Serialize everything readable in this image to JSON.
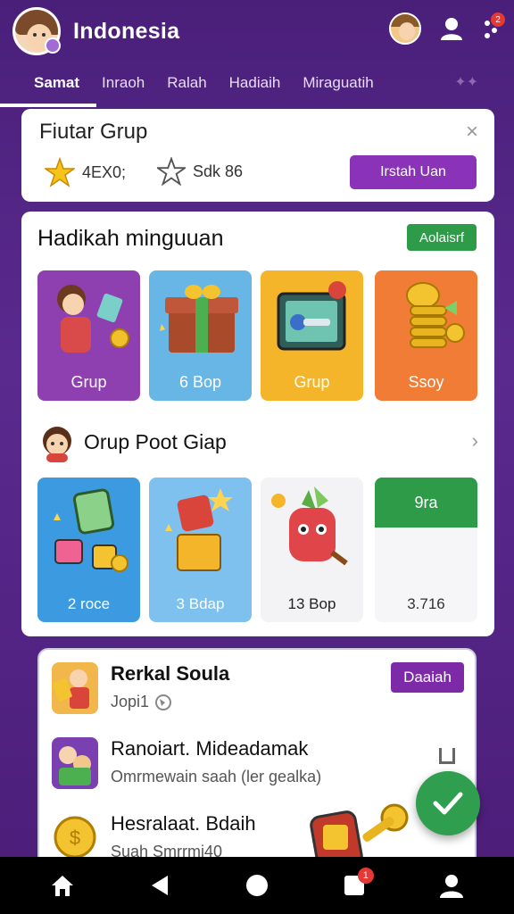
{
  "header": {
    "title": "Indonesia",
    "notification_badge": "2"
  },
  "tabs": [
    {
      "label": "Samat",
      "active": true
    },
    {
      "label": "Inraoh",
      "active": false
    },
    {
      "label": "Ralah",
      "active": false
    },
    {
      "label": "Hadiaih",
      "active": false
    },
    {
      "label": "Miraguatih",
      "active": false
    }
  ],
  "feature_card": {
    "title": "Fiutar Grup",
    "stat1": "4EX0;",
    "stat2": "Sdk 86",
    "button_label": "Irstah Uan",
    "close_glyph": "×"
  },
  "rewards": {
    "title": "Hadikah minguuan",
    "badge_label": "Aolaisrf",
    "tiles": [
      {
        "label": "Grup",
        "color": "#8e3fb0"
      },
      {
        "label": "6 Bop",
        "color": "#67b6e6"
      },
      {
        "label": "Grup",
        "color": "#f4b52a"
      },
      {
        "label": "Ssoy",
        "color": "#f07c35"
      }
    ]
  },
  "group_row": {
    "title": "Orup Poot Giap",
    "chevron": "›",
    "tiles": [
      {
        "label": "2 roce"
      },
      {
        "label": "3 Bdap"
      },
      {
        "label": "13 Bop"
      },
      {
        "label": "3.716",
        "badge": "9ra"
      }
    ]
  },
  "list": {
    "items": [
      {
        "title": "Rerkal Soula",
        "subtitle": "Jopi1",
        "button": "Daaiah"
      },
      {
        "title": "Ranoiart. Mideadamak",
        "subtitle": "Omrmewain saah (ler gealka)"
      },
      {
        "title": "Hesralaat. Bdaih",
        "subtitle": "Suah Smrrmi40"
      }
    ]
  },
  "colors": {
    "purple_bg": "#4a1f7a",
    "accent_purple": "#8a33b8",
    "accent_green": "#2e9b48"
  },
  "navbar": {
    "badge": "1",
    "icons": [
      "home-icon",
      "back-icon",
      "circle-home-icon",
      "square-notification-icon",
      "profile-icon"
    ]
  }
}
